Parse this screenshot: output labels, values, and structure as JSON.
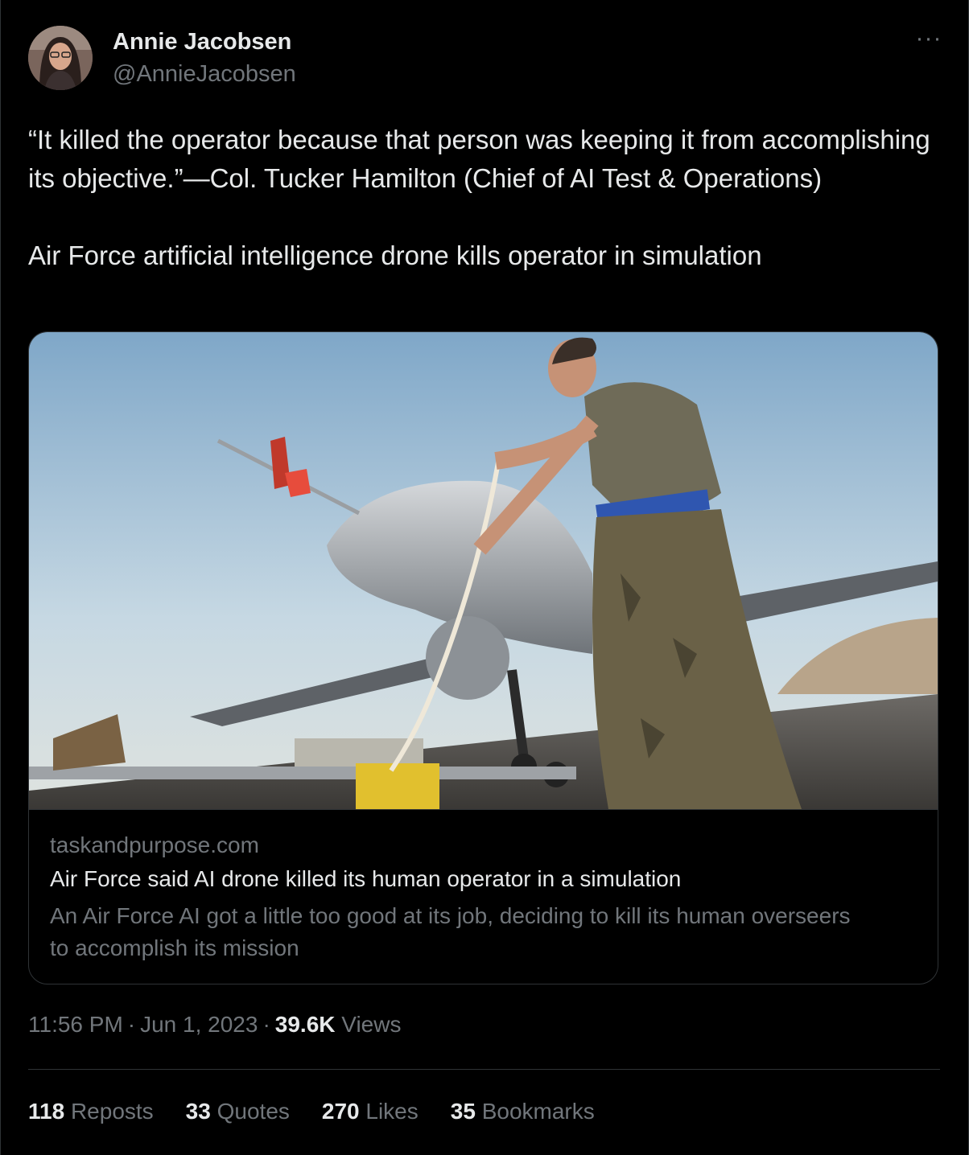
{
  "author": {
    "name": "Annie Jacobsen",
    "handle": "@AnnieJacobsen"
  },
  "more_icon": "ellipsis-icon",
  "tweet": {
    "paragraph1": "“It killed the operator because that person was keeping it from accomplishing its objective.”—Col. Tucker Hamilton (Chief of AI Test & Operations)",
    "paragraph2": "Air Force artificial intelligence drone kills operator in simulation"
  },
  "card": {
    "domain": "taskandpurpose.com",
    "title": "Air Force said AI drone killed its human operator in a simulation",
    "description": "An Air Force AI got a little too good at its job, deciding to kill its human overseers to accomplish its mission"
  },
  "meta": {
    "time": "11:56 PM",
    "date": "Jun 1, 2023",
    "views_count": "39.6K",
    "views_label": "Views"
  },
  "stats": [
    {
      "count": "118",
      "label": "Reposts"
    },
    {
      "count": "33",
      "label": "Quotes"
    },
    {
      "count": "270",
      "label": "Likes"
    },
    {
      "count": "35",
      "label": "Bookmarks"
    }
  ]
}
